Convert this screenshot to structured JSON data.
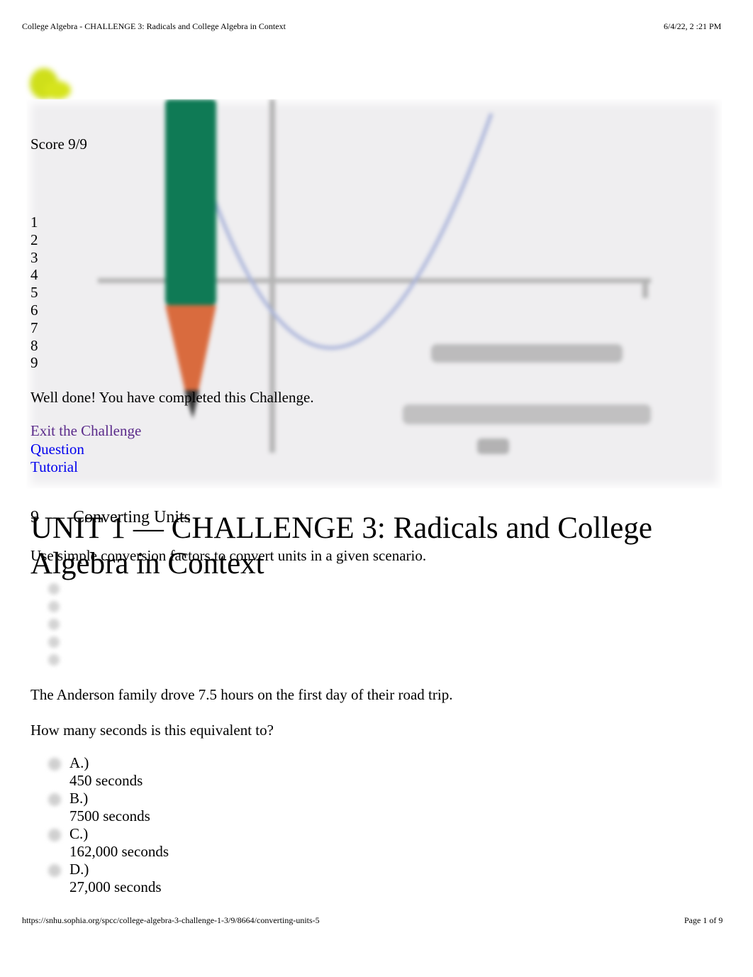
{
  "print_header": {
    "title": "College Algebra - CHALLENGE 3: Radicals and College Algebra in Context",
    "datetime": "6/4/22, 2   :21 PM"
  },
  "print_footer": {
    "url": "https://snhu.sophia.org/spcc/college-algebra-3-challenge-1-3/9/8664/converting-units-5",
    "page": "Page 1 of 9"
  },
  "banner": {
    "image_description": "pencil drawing a parabola on axes with quadratic formula",
    "formula_line1": "ax² + bx + c = 0",
    "formula_line2": "x₁,₂ = (−b ± √(b² − 4ac)) / 2a",
    "colors": {
      "pencil_body": "#0f7a55",
      "pencil_tip": "#d96b3e",
      "curve": "#a9b3d8",
      "axis": "#b0b0b0",
      "logo": "#d0e01a"
    }
  },
  "score": "Score 9/9",
  "question_nav": [
    "1",
    "2",
    "3",
    "4",
    "5",
    "6",
    "7",
    "8",
    "9"
  ],
  "completed_message": "Well done! You have completed this Challenge.",
  "links": {
    "exit": "Exit the Challenge",
    "question": "Question",
    "tutorial": "Tutorial"
  },
  "question_heading": "9  —  Converting Units",
  "unit_title": "UNIT 1 — CHALLENGE 3: Radicals and College Algebra in Context",
  "objective": "Use simple conversion factors to convert units in a given scenario.",
  "question": {
    "text": "The Anderson family drove 7.5 hours on the first day of their road trip.",
    "prompt": "How many seconds is this equivalent to?",
    "options": [
      {
        "letter": "A.)",
        "answer": "450 seconds"
      },
      {
        "letter": "B.)",
        "answer": "7500 seconds"
      },
      {
        "letter": "C.)",
        "answer": "162,000 seconds"
      },
      {
        "letter": "D.)",
        "answer": "27,000 seconds"
      }
    ]
  }
}
